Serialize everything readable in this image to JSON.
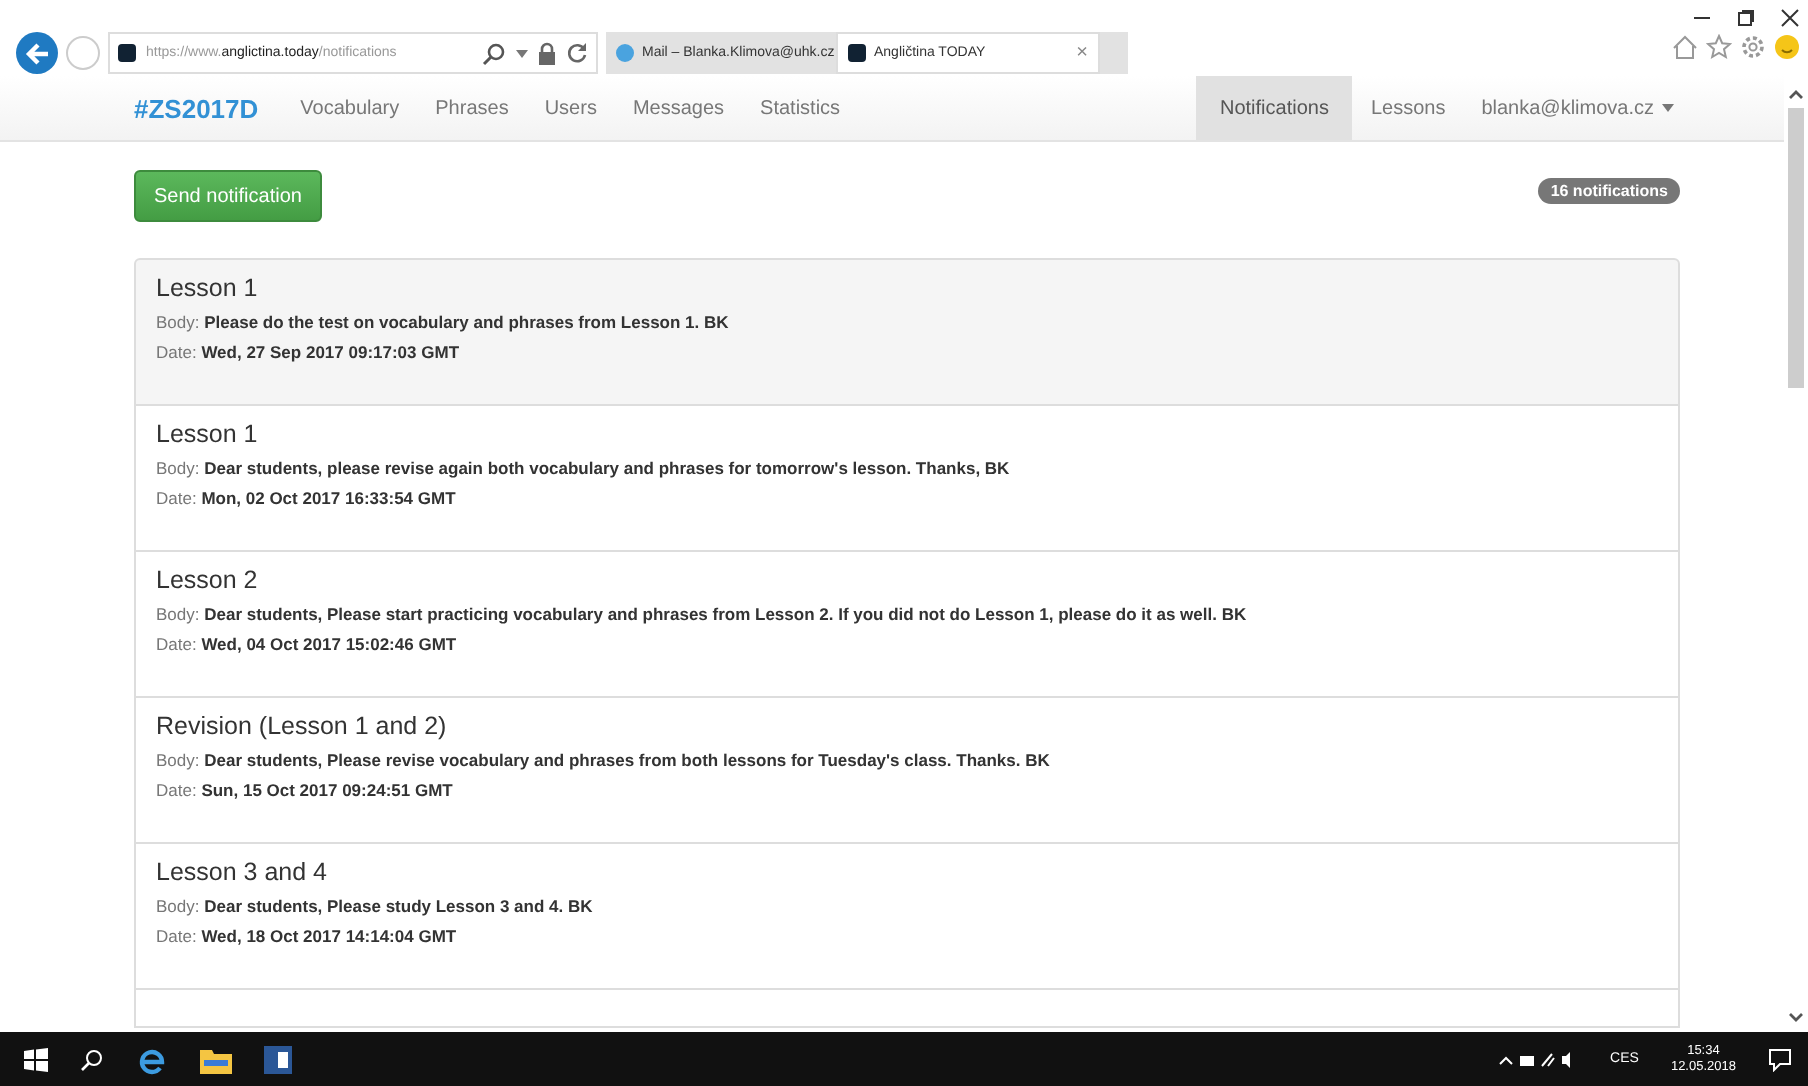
{
  "browser": {
    "address": {
      "scheme": "https://www.",
      "domain": "anglictina.today",
      "path": "/notifications"
    },
    "tabs": [
      {
        "label": "Mail – Blanka.Klimova@uhk.cz",
        "selected": false
      },
      {
        "label": "Angličtina TODAY",
        "selected": true,
        "close": "×"
      }
    ]
  },
  "navbar": {
    "brand": "#ZS2017D",
    "left_items": [
      {
        "label": "Vocabulary",
        "selected": false
      },
      {
        "label": "Phrases",
        "selected": false
      },
      {
        "label": "Users",
        "selected": false
      },
      {
        "label": "Messages",
        "selected": false
      },
      {
        "label": "Statistics",
        "selected": false
      }
    ],
    "right_items": [
      {
        "label": "Notifications",
        "selected": true
      },
      {
        "label": "Lessons",
        "selected": false
      }
    ],
    "user_menu": "blanka@klimova.cz"
  },
  "send_button": "Send notification",
  "count_badge": "16 notifications",
  "notifications": [
    {
      "title": "Lesson 1",
      "body": "Body: **Please do the test on vocabulary and phrases from Lesson 1. BK**",
      "date": "Date: **Wed, 27 Sep 2017 09:17:03 GMT**",
      "selected": true
    },
    {
      "title": "Lesson 1",
      "body": "Body: **Dear students, please revise again both vocabulary and phrases for tomorrow's lesson. Thanks, BK**",
      "date": "Date: **Mon, 02 Oct 2017 16:33:54 GMT**",
      "selected": false
    },
    {
      "title": "Lesson 2",
      "body": "Body: **Dear students, Please start practicing vocabulary and phrases from Lesson 2. If you did not do Lesson 1, please do it as well. BK**",
      "date": "Date: **Wed, 04 Oct 2017 15:02:46 GMT**",
      "selected": false
    },
    {
      "title": "Revision (Lesson 1 and 2)",
      "body": "Body: **Dear students, Please revise vocabulary and phrases from both lessons for Tuesday's class. Thanks. BK**",
      "date": "Date: **Sun, 15 Oct 2017 09:24:51 GMT**",
      "selected": false
    },
    {
      "title": "Lesson 3 and 4",
      "body": "Body: **Dear students, Please study Lesson 3 and 4. BK**",
      "date": "Date: **Wed, 18 Oct 2017 14:14:04 GMT**",
      "selected": false
    }
  ],
  "taskbar": {
    "language": "CES",
    "time": "15:34",
    "date": "12.05.2018"
  }
}
